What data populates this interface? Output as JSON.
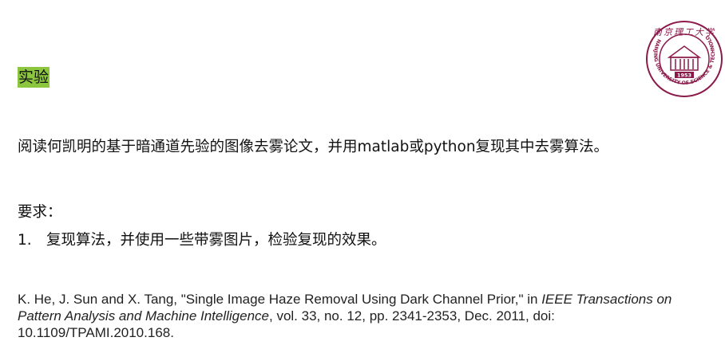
{
  "heading": "实验",
  "task": "阅读何凯明的基于暗通道先验的图像去雾论文，并用matlab或python复现其中去雾算法。",
  "requirements": {
    "label": "要求：",
    "items": [
      {
        "number": "1.",
        "text": "复现算法，并使用一些带雾图片，检验复现的效果。"
      }
    ]
  },
  "citation": {
    "authors_title": "K. He, J. Sun and X. Tang, \"Single Image Haze Removal Using Dark Channel Prior,\" in ",
    "journal": "IEEE Transactions on Pattern Analysis and Machine Intelligence",
    "details": ", vol. 33, no. 12, pp. 2341-2353, Dec. 2011, doi: 10.1109/TPAMI.2010.168."
  },
  "logo": {
    "top_text": "南京理工大学",
    "ring_text": "NANJING UNIVERSITY OF SCIENCE & TECHNOLOGY",
    "year": "1953",
    "color": "#8b1a4a"
  }
}
